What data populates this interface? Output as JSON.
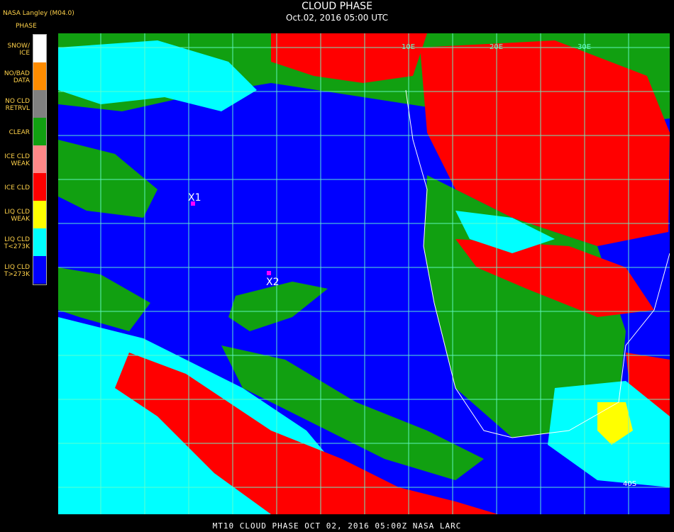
{
  "header": {
    "org": "NASA Langley (M04.0)",
    "title": "CLOUD PHASE",
    "subtitle": "Oct.02, 2016 05:00 UTC"
  },
  "legend": {
    "title": "PHASE",
    "items": [
      {
        "label": "SNOW/\nICE",
        "color": "#ffffff"
      },
      {
        "label": "NO/BAD\nDATA",
        "color": "#ff8c00"
      },
      {
        "label": "NO CLD\nRETRVL",
        "color": "#808080"
      },
      {
        "label": "CLEAR",
        "color": "#11a011"
      },
      {
        "label": "ICE CLD\nWEAK",
        "color": "#ff8888"
      },
      {
        "label": "ICE CLD",
        "color": "#ff0000"
      },
      {
        "label": "LIQ CLD\nWEAK",
        "color": "#ffff00"
      },
      {
        "label": "LIQ CLD\nT<273K",
        "color": "#00ffff"
      },
      {
        "label": "LIQ CLD\nT>273K",
        "color": "#0000ff"
      }
    ]
  },
  "map": {
    "markers": [
      {
        "label": "X1",
        "color": "#ff00ff"
      },
      {
        "label": "X2",
        "color": "#ff00ff"
      }
    ],
    "coord_labels": {
      "lon_labels": [
        "10E",
        "20E",
        "30E"
      ],
      "lat_label": "40S"
    },
    "colors": {
      "ocean": "#0000ff",
      "land": "#11a011",
      "ice": "#ff0000",
      "cold_liq": "#00ffff",
      "grid": "#66ffcc"
    }
  },
  "footer": {
    "text": "MT10  CLOUD PHASE  OCT 02, 2016 05:00Z  NASA LARC"
  }
}
